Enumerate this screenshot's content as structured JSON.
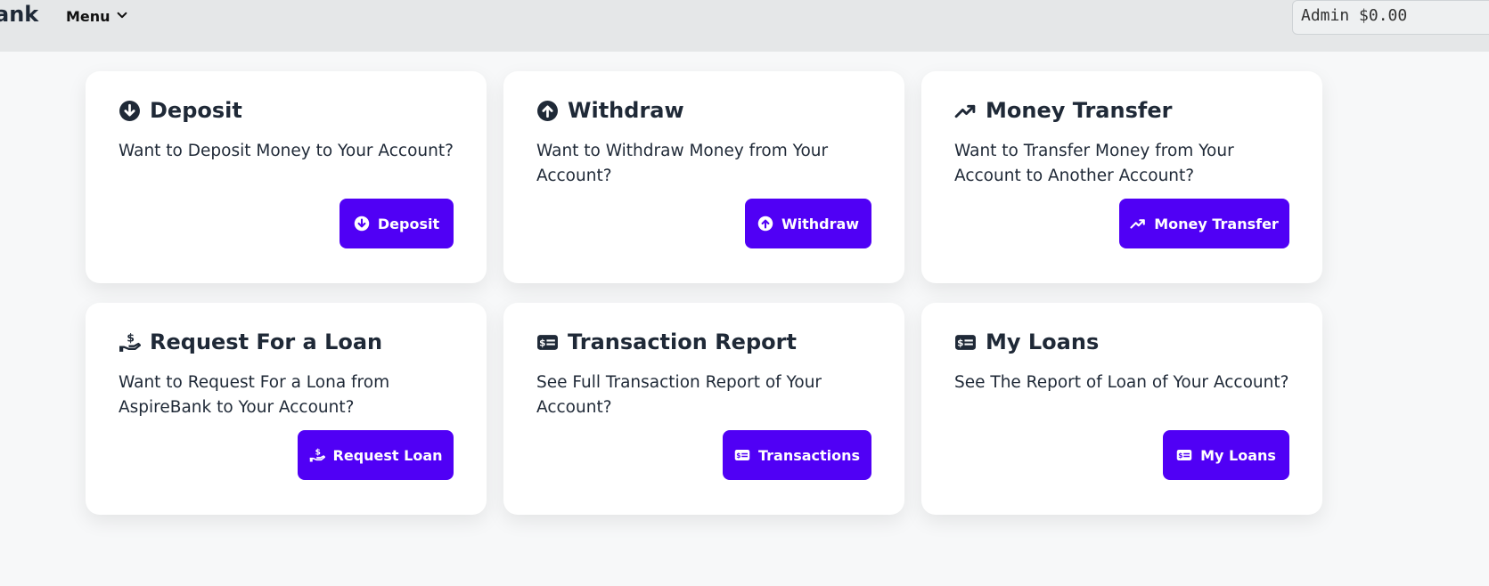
{
  "navbar": {
    "brand": "ank",
    "menu_label": "Menu",
    "user_badge": "Admin $0.00"
  },
  "cards": [
    {
      "title": "Deposit",
      "description": "Want to Deposit Money to Your Account?",
      "button": "Deposit",
      "icon": "arrow-down-circle-icon"
    },
    {
      "title": "Withdraw",
      "description": "Want to Withdraw Money from Your Account?",
      "button": "Withdraw",
      "icon": "arrow-up-circle-icon"
    },
    {
      "title": "Money Transfer",
      "description": "Want to Transfer Money from Your Account to Another Account?",
      "button": "Money Transfer",
      "icon": "trending-up-icon"
    },
    {
      "title": "Request For a Loan",
      "description": "Want to Request For a Lona from AspireBank to Your Account?",
      "button": "Request Loan",
      "icon": "hand-dollar-icon"
    },
    {
      "title": "Transaction Report",
      "description": "See Full Transaction Report of Your Account?",
      "button": "Transactions",
      "icon": "money-check-icon"
    },
    {
      "title": "My Loans",
      "description": "See The Report of Loan of Your Account?",
      "button": "My Loans",
      "icon": "money-check-icon"
    }
  ],
  "colors": {
    "accent": "#5000f5",
    "navbar": "#e5e7e8",
    "text": "#1f2937"
  }
}
